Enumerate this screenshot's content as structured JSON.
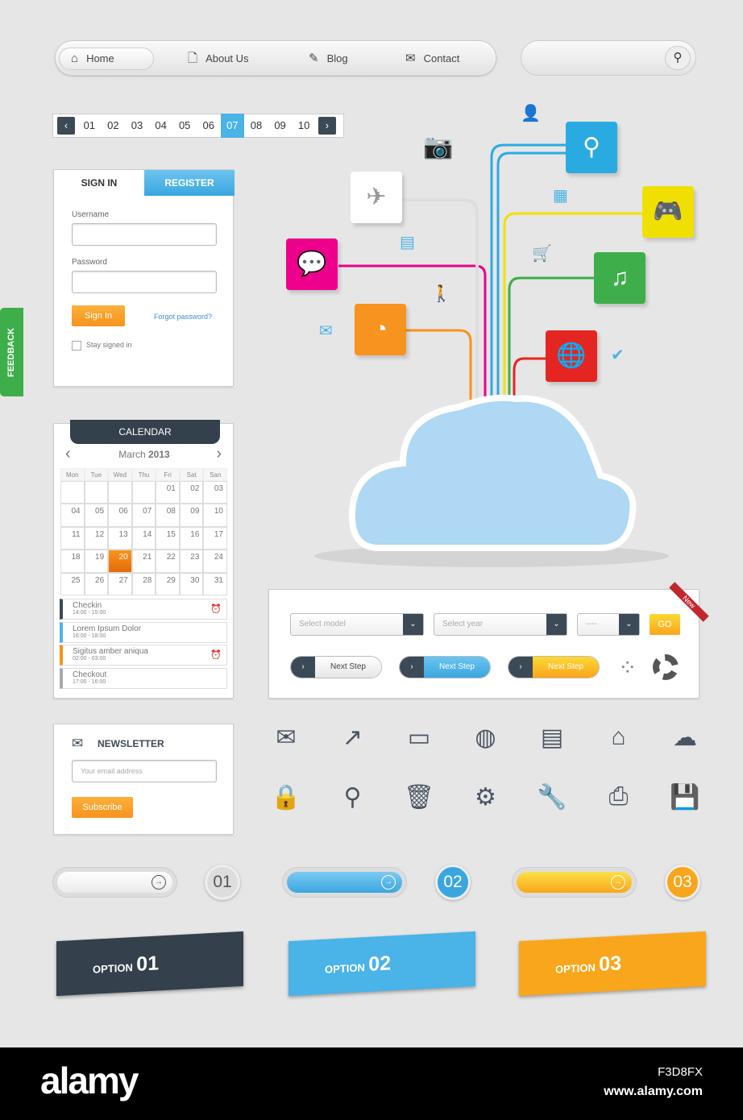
{
  "nav": {
    "items": [
      {
        "label": "Home",
        "icon": "home-icon"
      },
      {
        "label": "About Us",
        "icon": "document-icon"
      },
      {
        "label": "Blog",
        "icon": "pencil-icon"
      },
      {
        "label": "Contact",
        "icon": "mail-icon"
      }
    ]
  },
  "search": {
    "placeholder": "",
    "icon": "search-icon"
  },
  "pager": {
    "pages": [
      "01",
      "02",
      "03",
      "04",
      "05",
      "06",
      "07",
      "08",
      "09",
      "10"
    ],
    "current": "07"
  },
  "signin": {
    "tab_signin": "SIGN IN",
    "tab_register": "REGISTER",
    "username_label": "Username",
    "password_label": "Password",
    "button": "Sign In",
    "forgot": "Forgot password?",
    "stay": "Stay signed in"
  },
  "feedback": "FEEDBACK",
  "calendar": {
    "title": "CALENDAR",
    "month": "March",
    "year": "2013",
    "days": [
      "Mon",
      "Tue",
      "Wed",
      "Thu",
      "Fri",
      "Sat",
      "San"
    ],
    "cells": [
      "",
      "",
      "",
      "",
      "01",
      "02",
      "03",
      "04",
      "05",
      "06",
      "07",
      "08",
      "09",
      "10",
      "11",
      "12",
      "13",
      "14",
      "15",
      "16",
      "17",
      "18",
      "19",
      "20",
      "21",
      "22",
      "23",
      "24",
      "25",
      "26",
      "27",
      "28",
      "29",
      "30",
      "31"
    ],
    "selected": "20",
    "events": [
      {
        "title": "Checkin",
        "time": "14:00 - 15:00",
        "color": "#3c4a58",
        "alarm": true
      },
      {
        "title": "Lorem Ipsum Dolor",
        "time": "16:00 - 18:00",
        "color": "#4ab3e8",
        "alarm": false
      },
      {
        "title": "Sigitus amber aniqua",
        "time": "02:00 - 03:00",
        "color": "#f7931e",
        "alarm": true
      },
      {
        "title": "Checkout",
        "time": "17:00 - 16:00",
        "color": "#aaaaaa",
        "alarm": false
      }
    ]
  },
  "form": {
    "model_placeholder": "Select model",
    "year_placeholder": "Select year",
    "third": "----",
    "go": "GO",
    "badge": "New",
    "next": "Next Step"
  },
  "newsletter": {
    "title": "NEWSLETTER",
    "placeholder": "Your email address",
    "button": "Subscribe"
  },
  "icons_row1": [
    "mail-icon",
    "chart-icon",
    "chat-icon",
    "globe-icon",
    "id-card-icon",
    "home-icon",
    "cloud-icon"
  ],
  "icons_row2": [
    "lock-icon",
    "search-icon",
    "trash-icon",
    "gear-icon",
    "wrench-icon",
    "printer-icon",
    "save-icon"
  ],
  "steps": [
    "01",
    "02",
    "03"
  ],
  "options": [
    {
      "word": "OPTION",
      "num": "01",
      "color": "#34404c"
    },
    {
      "word": "OPTION",
      "num": "02",
      "color": "#4ab3e8"
    },
    {
      "word": "OPTION",
      "num": "03",
      "color": "#f9a61c"
    }
  ],
  "footer": {
    "logo": "alamy",
    "id": "F3D8FX",
    "url": "www.alamy.com"
  },
  "colors": {
    "accent": "#4ab3e8",
    "orange": "#f7931e",
    "dark": "#3c4a58",
    "green": "#3dae49"
  }
}
